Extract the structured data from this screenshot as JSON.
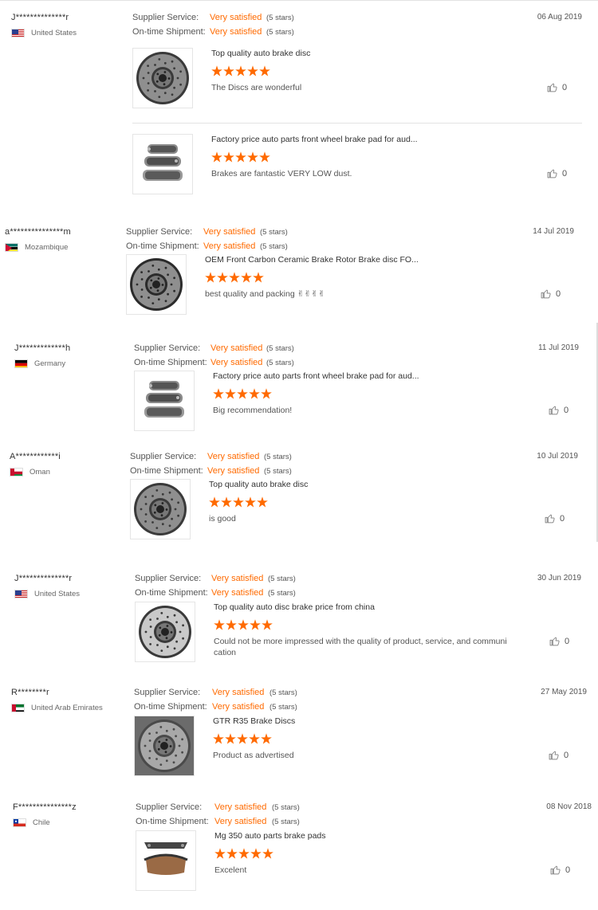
{
  "labels": {
    "supplier_service": "Supplier Service:",
    "ontime_shipment": "On-time Shipment:"
  },
  "colors": {
    "accent": "#ff6a00",
    "text": "#333333",
    "muted": "#666666",
    "divider": "#e3e3e3"
  },
  "reviews": [
    {
      "buyer": "J**************r",
      "country": "United States",
      "flag": "us",
      "date": "06 Aug 2019",
      "supplier_service": "Very satisfied",
      "supplier_stars": "(5 stars)",
      "ontime_shipment": "Very satisfied",
      "ontime_stars": "(5 stars)",
      "items": [
        {
          "title": "Top quality auto brake disc",
          "rating": 5,
          "comment": "The Discs are wonderful",
          "likes": "0",
          "image": "drilled-disc"
        },
        {
          "title": "Factory price auto parts front wheel brake pad for aud...",
          "rating": 5,
          "comment": "Brakes are fantastic VERY LOW dust.",
          "likes": "0",
          "image": "brake-pads"
        }
      ]
    },
    {
      "buyer": "a***************m",
      "country": "Mozambique",
      "flag": "mz",
      "date": "14 Jul 2019",
      "supplier_service": "Very satisfied",
      "supplier_stars": "(5 stars)",
      "ontime_shipment": "Very satisfied",
      "ontime_stars": "(5 stars)",
      "items": [
        {
          "title": "OEM Front Carbon Ceramic Brake Rotor Brake disc FO...",
          "rating": 5,
          "comment": "best quality and packing ✌✌✌✌",
          "likes": "0",
          "image": "ceramic-disc"
        }
      ]
    },
    {
      "buyer": "J*************h",
      "country": "Germany",
      "flag": "de",
      "date": "11 Jul 2019",
      "supplier_service": "Very satisfied",
      "supplier_stars": "(5 stars)",
      "ontime_shipment": "Very satisfied",
      "ontime_stars": "(5 stars)",
      "items": [
        {
          "title": "Factory price auto parts front wheel brake pad for aud...",
          "rating": 5,
          "comment": "Big recommendation!",
          "likes": "0",
          "image": "brake-pads"
        }
      ]
    },
    {
      "buyer": "A************i",
      "country": "Oman",
      "flag": "om",
      "date": "10 Jul 2019",
      "supplier_service": "Very satisfied",
      "supplier_stars": "(5 stars)",
      "ontime_shipment": "Very satisfied",
      "ontime_stars": "(5 stars)",
      "items": [
        {
          "title": "Top quality auto brake disc",
          "rating": 5,
          "comment": "is good",
          "likes": "0",
          "image": "drilled-disc"
        }
      ]
    },
    {
      "buyer": "J**************r",
      "country": "United States",
      "flag": "us",
      "date": "30 Jun 2019",
      "supplier_service": "Very satisfied",
      "supplier_stars": "(5 stars)",
      "ontime_shipment": "Very satisfied",
      "ontime_stars": "(5 stars)",
      "items": [
        {
          "title": "Top quality auto disc brake price from china",
          "rating": 5,
          "comment": "Could not be more impressed with the quality of product, service, and communi cation",
          "likes": "0",
          "image": "silver-disc"
        }
      ]
    },
    {
      "buyer": "R********r",
      "country": "United Arab Emirates",
      "flag": "ae",
      "date": "27 May 2019",
      "supplier_service": "Very satisfied",
      "supplier_stars": "(5 stars)",
      "ontime_shipment": "Very satisfied",
      "ontime_stars": "(5 stars)",
      "items": [
        {
          "title": "GTR R35 Brake Discs",
          "rating": 5,
          "comment": "Product as advertised",
          "likes": "0",
          "image": "gtr-disc"
        }
      ]
    },
    {
      "buyer": "F***************z",
      "country": "Chile",
      "flag": "cl",
      "date": "08 Nov 2018",
      "supplier_service": "Very satisfied",
      "supplier_stars": "(5 stars)",
      "ontime_shipment": "Very satisfied",
      "ontime_stars": "(5 stars)",
      "items": [
        {
          "title": "Mg 350 auto parts brake pads",
          "rating": 5,
          "comment": "Excelent",
          "likes": "0",
          "image": "rear-pads"
        }
      ]
    }
  ]
}
